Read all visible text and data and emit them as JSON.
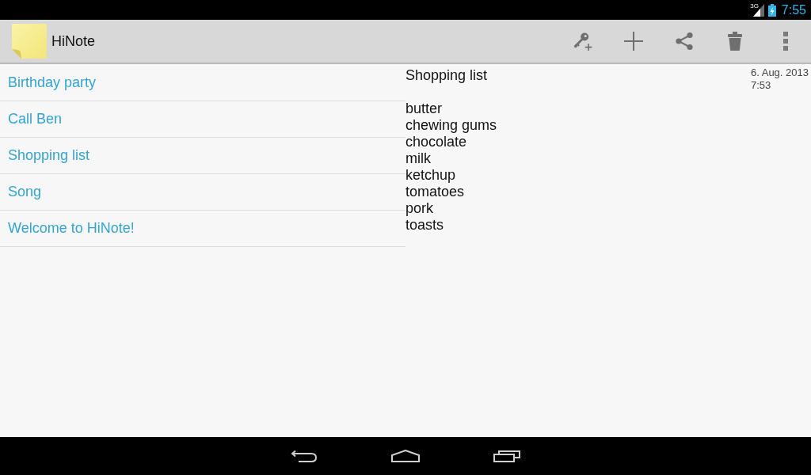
{
  "status_bar": {
    "network": "3G",
    "time": "7:55"
  },
  "action_bar": {
    "title": "HiNote"
  },
  "notes": [
    {
      "title": "Birthday party"
    },
    {
      "title": "Call Ben"
    },
    {
      "title": "Shopping list"
    },
    {
      "title": "Song"
    },
    {
      "title": "Welcome to HiNote!"
    }
  ],
  "detail": {
    "title": "Shopping list",
    "date": "6. Aug. 2013",
    "time": "7:53",
    "body": "butter\nchewing gums\nchocolate\nmilk\nketchup\ntomatoes\npork\ntoasts"
  }
}
